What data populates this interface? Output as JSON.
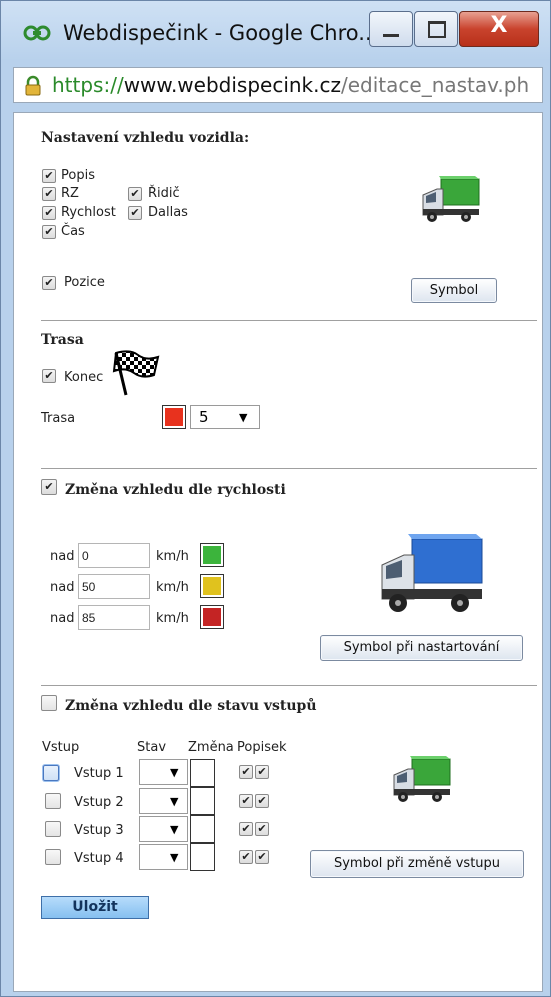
{
  "window": {
    "title": "Webdispečink - Google Chro...",
    "close_label": "X",
    "url_scheme": "https://",
    "url_host": "www.webdispecink.cz",
    "url_path": "/editace_nastav.ph"
  },
  "vehicle_look": {
    "heading": "Nastavení vzhledu vozidla:",
    "checks": {
      "popis": "Popis",
      "rz": "RZ",
      "ridic": "Řidič",
      "rychlost": "Rychlost",
      "dallas": "Dallas",
      "cas": "Čas",
      "pozice": "Pozice"
    },
    "symbol_button": "Symbol"
  },
  "route": {
    "heading": "Trasa",
    "konec_label": "Konec",
    "trasa_label": "Trasa",
    "color": "#e8321e",
    "width_value": "5"
  },
  "speed": {
    "heading": "Změna vzhledu dle rychlosti",
    "rows": [
      {
        "prefix": "nad",
        "value": "0",
        "unit": "km/h",
        "color": "#3cb43c"
      },
      {
        "prefix": "nad",
        "value": "50",
        "unit": "km/h",
        "color": "#e0c21e"
      },
      {
        "prefix": "nad",
        "value": "85",
        "unit": "km/h",
        "color": "#c42424"
      }
    ],
    "symbol_button": "Symbol při nastartování"
  },
  "inputs": {
    "heading": "Změna vzhledu dle stavu vstupů",
    "col_vstup": "Vstup",
    "col_stav": "Stav",
    "col_zmena": "Změna",
    "col_popisek": "Popisek",
    "rows": [
      {
        "label": "Vstup 1"
      },
      {
        "label": "Vstup 2"
      },
      {
        "label": "Vstup 3"
      },
      {
        "label": "Vstup 4"
      }
    ],
    "symbol_button": "Symbol při změně vstupu"
  },
  "save_button": "Uložit",
  "colors": {
    "truck_green": "#3aa63a",
    "truck_blue": "#2f6fd1",
    "accent_save": "#9ccff7"
  }
}
